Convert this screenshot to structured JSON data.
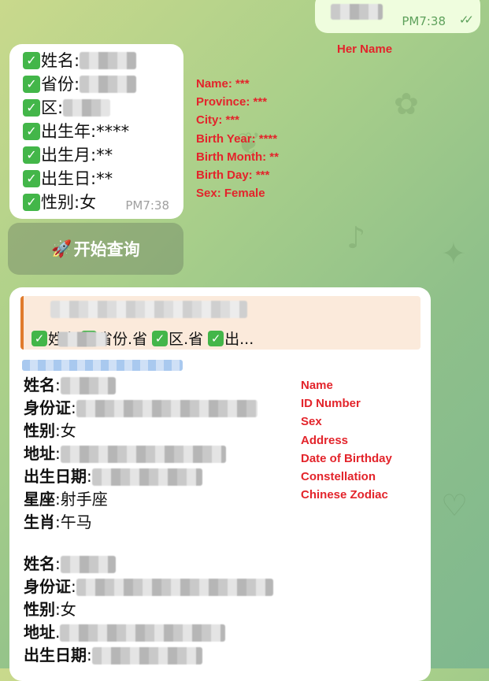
{
  "outgoing": {
    "time": "PM7:38",
    "status_icon": "double-check-icon"
  },
  "annotations": {
    "her_name": "Her Name",
    "field_labels": [
      "Name: ***",
      "Province: ***",
      "City: ***",
      "Birth Year: ****",
      "Birth Month: **",
      "Birth Day: ***",
      "Sex: Female"
    ],
    "result_labels": [
      "Name",
      "ID Number",
      "Sex",
      "Address",
      "Date of Birthday",
      "Constellation",
      "Chinese Zodiac"
    ]
  },
  "query_message": {
    "rows": [
      {
        "label": "姓名:",
        "value": ""
      },
      {
        "label": "省份:",
        "value": ""
      },
      {
        "label": "区:",
        "value": ""
      },
      {
        "label": "出生年:",
        "value": "****"
      },
      {
        "label": "出生月:",
        "value": "**"
      },
      {
        "label": "出生日:",
        "value": "**"
      },
      {
        "label": "性别:",
        "value": "女"
      }
    ],
    "time": "PM7:38"
  },
  "start_button": {
    "icon": "rocket-icon",
    "label": "开始查询"
  },
  "results": {
    "quote_line": {
      "name_label": "姓名",
      "province_label": "省份.",
      "province_suffix": "省",
      "district_label": "区.",
      "district_suffix": "省",
      "more_label": "出..."
    },
    "records": [
      {
        "name_label": "姓名",
        "id_label": "身份证",
        "sex_label": "性别",
        "sex_value": "女",
        "address_label": "地址",
        "birthdate_label": "出生日期",
        "constellation_label": "星座",
        "constellation_value": "射手座",
        "zodiac_label": "生肖",
        "zodiac_value": "午马"
      },
      {
        "name_label": "姓名",
        "id_label": "身份证",
        "sex_label": "性别",
        "sex_value": "女",
        "address_label": "地址",
        "birthdate_label": "出生日期"
      }
    ]
  }
}
